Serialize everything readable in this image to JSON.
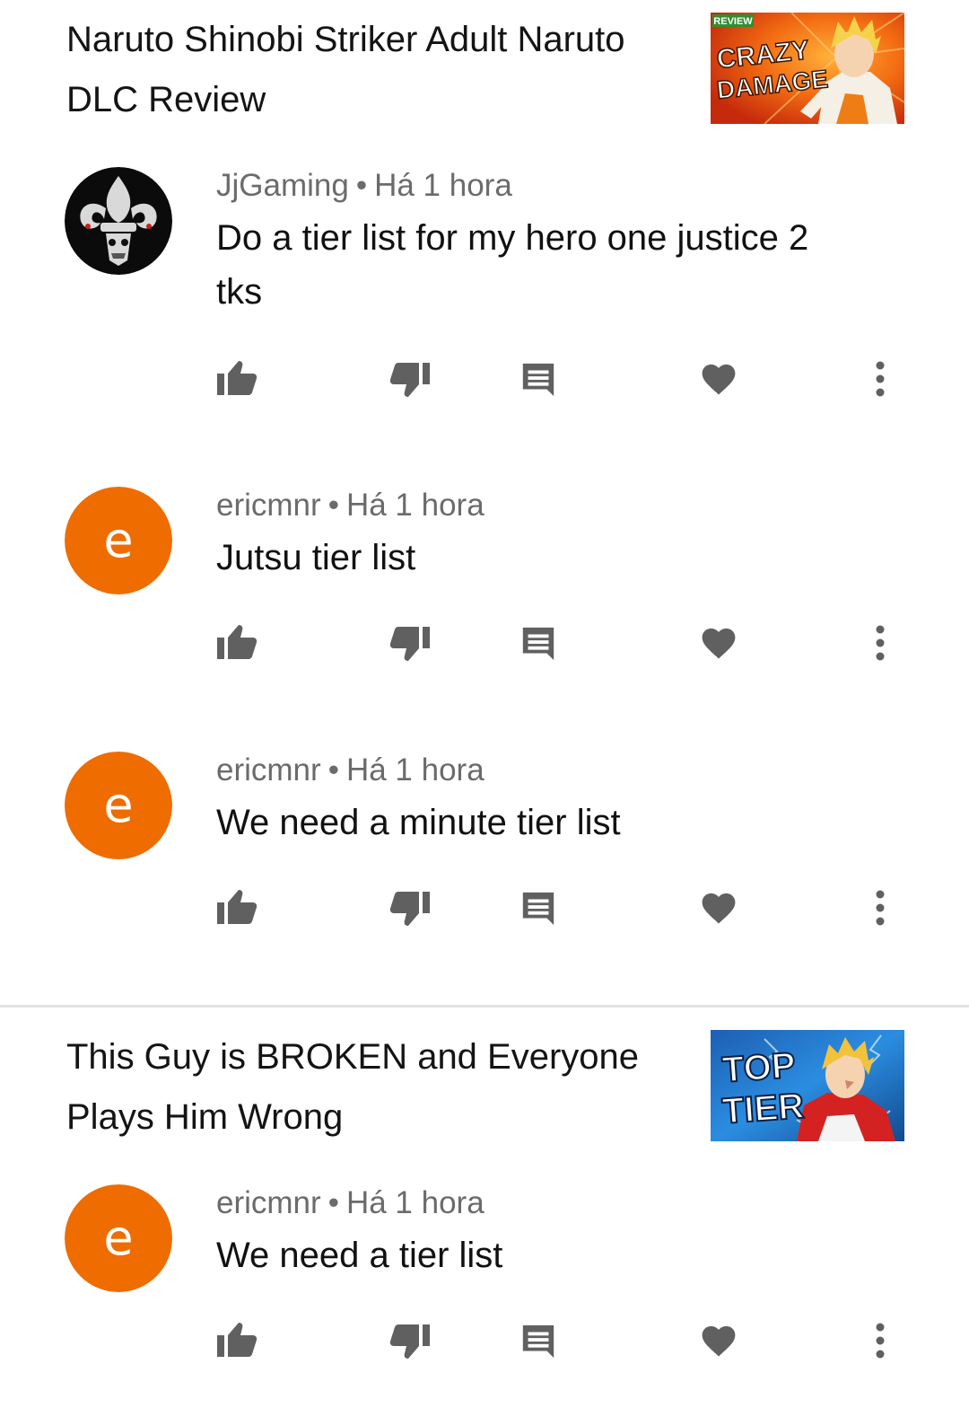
{
  "videos": [
    {
      "title": "Naruto Shinobi Striker Adult Naruto DLC Review",
      "thumbnail": {
        "badge": "REVIEW",
        "line1": "CRAZY",
        "line2": "DAMAGE"
      }
    },
    {
      "title": "This Guy is BROKEN and Everyone Plays Him Wrong",
      "thumbnail": {
        "line1": "TOP",
        "line2": "TIER"
      }
    }
  ],
  "comments": [
    {
      "author": "JjGaming",
      "time": "Há 1 hora",
      "text": "Do a tier list for my hero one justice 2 tks",
      "avatar": "fleur-de-lis-skull-icon"
    },
    {
      "author": "ericmnr",
      "time": "Há 1 hora",
      "text": "Jutsu tier list",
      "avatar_letter": "e"
    },
    {
      "author": "ericmnr",
      "time": "Há 1 hora",
      "text": "We need a minute tier list",
      "avatar_letter": "e"
    },
    {
      "author": "ericmnr",
      "time": "Há 1 hora",
      "text": "We need a tier list",
      "avatar_letter": "e"
    }
  ],
  "separator": "•",
  "actions": [
    "thumb-up-icon",
    "thumb-down-icon",
    "reply-icon",
    "heart-icon",
    "more-vert-icon"
  ],
  "colors": {
    "avatar_orange": "#ef6c00",
    "icon_gray": "#606060",
    "meta_gray": "#6b6b6b"
  }
}
